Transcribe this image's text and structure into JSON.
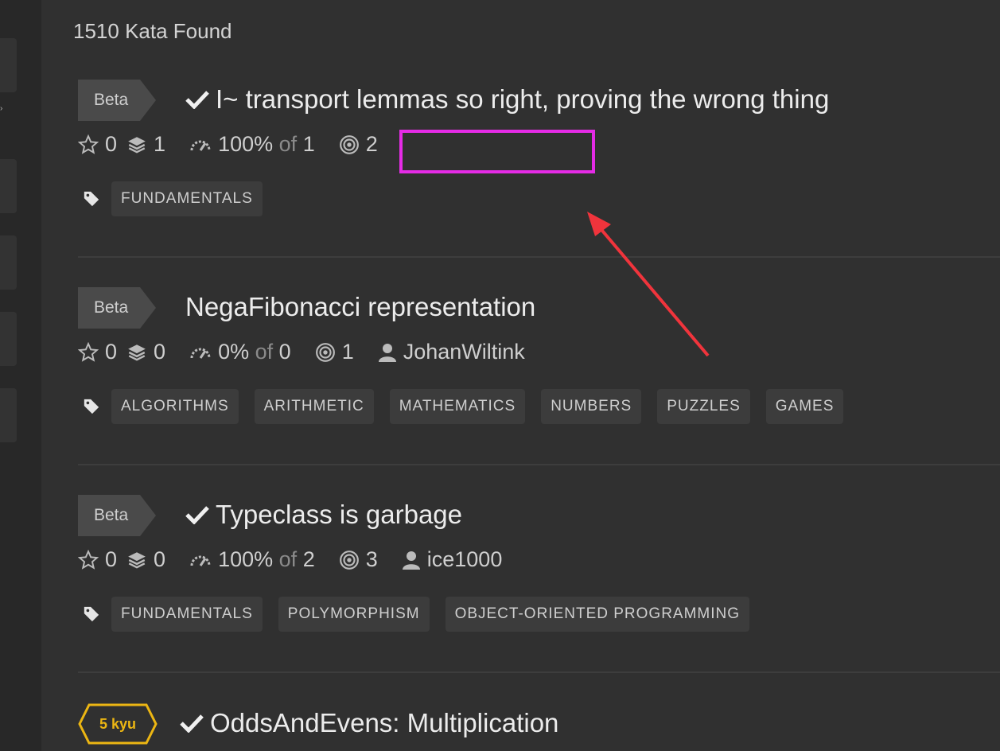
{
  "results": {
    "count_label": "1510 Kata Found"
  },
  "colors": {
    "accent_kyu": "#ecb613",
    "highlight": "#e52be6",
    "arrow": "#f0343c"
  },
  "katas": [
    {
      "badge": "Beta",
      "completed": true,
      "title": "I~ transport lemmas so right, proving the wrong thing",
      "stars": "0",
      "collections": "1",
      "satisfaction": "100%",
      "of_label": "of",
      "votes": "1",
      "completions": "2",
      "author": "",
      "tags": [
        "FUNDAMENTALS"
      ]
    },
    {
      "badge": "Beta",
      "completed": false,
      "title": "NegaFibonacci representation",
      "stars": "0",
      "collections": "0",
      "satisfaction": "0%",
      "of_label": "of",
      "votes": "0",
      "completions": "1",
      "author": "JohanWiltink",
      "tags": [
        "ALGORITHMS",
        "ARITHMETIC",
        "MATHEMATICS",
        "NUMBERS",
        "PUZZLES",
        "GAMES"
      ]
    },
    {
      "badge": "Beta",
      "completed": true,
      "title": "Typeclass is garbage",
      "stars": "0",
      "collections": "0",
      "satisfaction": "100%",
      "of_label": "of",
      "votes": "2",
      "completions": "3",
      "author": "ice1000",
      "tags": [
        "FUNDAMENTALS",
        "POLYMORPHISM",
        "OBJECT-ORIENTED PROGRAMMING"
      ]
    },
    {
      "badge": "5 kyu",
      "completed": true,
      "title": "OddsAndEvens: Multiplication"
    }
  ]
}
